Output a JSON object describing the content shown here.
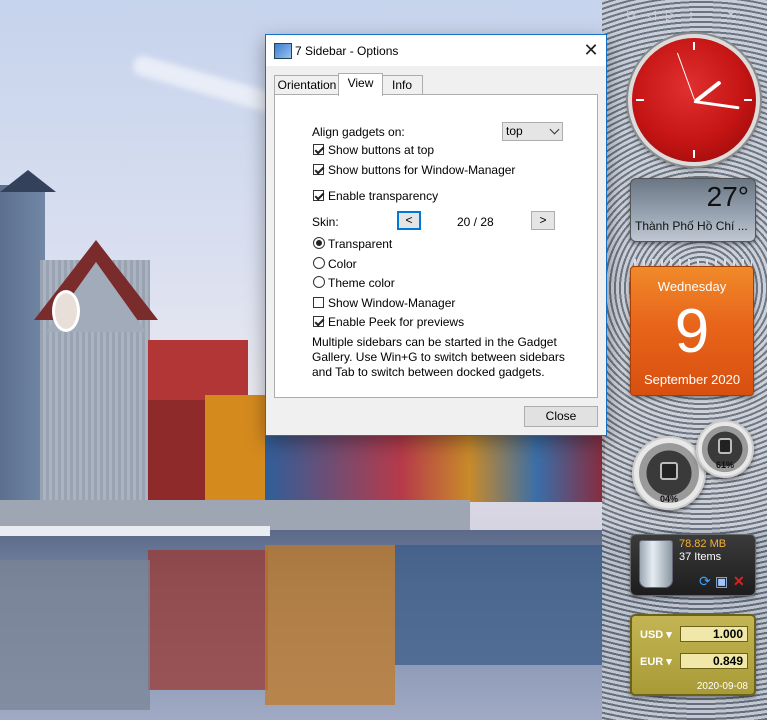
{
  "dialog": {
    "title": "7 Sidebar - Options",
    "close_glyph": "✕",
    "tabs": [
      {
        "label": "Orientation",
        "active": false
      },
      {
        "label": "View",
        "active": true
      },
      {
        "label": "Info",
        "active": false
      }
    ],
    "align_label": "Align gadgets on:",
    "align_value": "top",
    "checkboxes": [
      {
        "label": "Show buttons at top",
        "checked": true
      },
      {
        "label": "Show buttons for Window-Manager",
        "checked": true
      },
      {
        "label": "Enable transparency",
        "checked": true
      }
    ],
    "skin": {
      "label": "Skin:",
      "prev": "<",
      "next": ">",
      "counter": "20 / 28"
    },
    "radios": [
      {
        "label": "Transparent",
        "selected": true
      },
      {
        "label": "Color",
        "selected": false
      },
      {
        "label": "Theme color",
        "selected": false
      }
    ],
    "checkboxes2": [
      {
        "label": "Show Window-Manager",
        "checked": false
      },
      {
        "label": "Enable Peek for previews",
        "checked": true
      }
    ],
    "note": "Multiple sidebars can be started in the Gadget Gallery. Use Win+G to switch between sidebars and Tab to switch between docked gadgets.",
    "close_button": "Close"
  },
  "sidebar": {
    "top_buttons": [
      "⧉",
      "◁",
      "▷",
      "+",
      "−",
      "✕"
    ],
    "weather": {
      "temp": "27°",
      "city": "Thành Phố Hồ Chí ..."
    },
    "calendar": {
      "weekday": "Wednesday",
      "day": "9",
      "month_year": "September 2020"
    },
    "meters": {
      "cpu": "04%",
      "ram": "61%"
    },
    "recycle_bin": {
      "size": "78.82 MB",
      "items": "37 Items"
    },
    "currency": {
      "rows": [
        {
          "code": "USD ▾",
          "value": "1.000"
        },
        {
          "code": "EUR ▾",
          "value": "0.849"
        }
      ],
      "date": "2020-09-08"
    }
  }
}
